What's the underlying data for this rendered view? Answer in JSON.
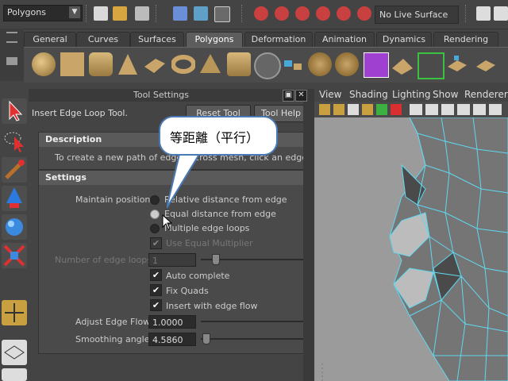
{
  "toolbar": {
    "mode": "Polygons",
    "live_surface": "No Live Surface"
  },
  "shelf": {
    "tabs": [
      "General",
      "Curves",
      "Surfaces",
      "Polygons",
      "Deformation",
      "Animation",
      "Dynamics",
      "Rendering"
    ],
    "active_tab": "Polygons"
  },
  "tool_settings": {
    "title": "Tool Settings",
    "tool_name": "Insert Edge Loop Tool.",
    "reset_button": "Reset Tool",
    "help_button": "Tool Help",
    "description_header": "Description",
    "description_text": "To create a new path of edges across mesh, click an edge and d",
    "settings_header": "Settings",
    "maintain_position_label": "Maintain position:",
    "options": [
      {
        "label": "Relative distance from edge",
        "selected": false
      },
      {
        "label": "Equal distance from edge",
        "selected": true
      },
      {
        "label": "Multiple edge loops",
        "selected": false
      }
    ],
    "use_equal_multiplier": "Use Equal Multiplier",
    "num_loops_label": "Number of edge loops:",
    "num_loops_value": "1",
    "auto_complete": "Auto complete",
    "fix_quads": "Fix Quads",
    "insert_with_edge_flow": "Insert with edge flow",
    "adjust_edge_flow_label": "Adjust Edge Flow",
    "adjust_edge_flow_value": "1.0000",
    "smoothing_angle_label": "Smoothing angle:",
    "smoothing_angle_value": "4.5860"
  },
  "callout": {
    "text": "等距離（平行）"
  },
  "viewport": {
    "menu": [
      "View",
      "Shading",
      "Lighting",
      "Show",
      "Renderer"
    ]
  },
  "colors": {
    "panel": "#444444",
    "active_tab": "#5d5d5d",
    "mesh_wire": "#5fd8f0",
    "callout_border": "#4a7ab5"
  }
}
